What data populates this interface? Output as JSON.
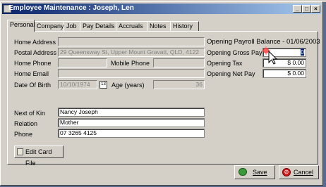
{
  "window": {
    "title": "Employee Maintenance : Joseph, Len"
  },
  "tabs": [
    "Personal",
    "Company",
    "Job",
    "Pay Details",
    "Accruals",
    "Notes",
    "History"
  ],
  "personal": {
    "home_address_label": "Home Address",
    "home_address_value": "",
    "postal_address_label": "Postal Address",
    "postal_address_value": "29 Queensway St, Upper Mount Gravatt, QLD, 4122",
    "home_phone_label": "Home Phone",
    "home_phone_value": "",
    "mobile_phone_label": "Mobile Phone",
    "mobile_phone_value": "",
    "home_email_label": "Home Email",
    "home_email_value": "",
    "dob_label": "Date Of Birth",
    "dob_value": "10/10/1974",
    "age_label": "Age (years)",
    "age_value": "36",
    "next_of_kin_label": "Next of Kin",
    "next_of_kin_value": "Nancy Joseph",
    "relation_label": "Relation",
    "relation_value": "Mother",
    "phone_label": "Phone",
    "phone_value": "07 3265 4125"
  },
  "opening": {
    "heading": "Opening Payroll Balance - 01/06/2003",
    "gross_pay_label": "Opening Gross Pay",
    "gross_pay_value": "0",
    "tax_label": "Opening Tax",
    "tax_value": "$ 0.00",
    "net_pay_label": "Opening Net Pay",
    "net_pay_value": "$ 0.00"
  },
  "buttons": {
    "edit_card_file": "Edit Card File",
    "save": "Save",
    "cancel": "Cancel"
  },
  "colors": {
    "title_start": "#0a246a",
    "title_end": "#a6caf0",
    "face": "#d4d0c8"
  }
}
